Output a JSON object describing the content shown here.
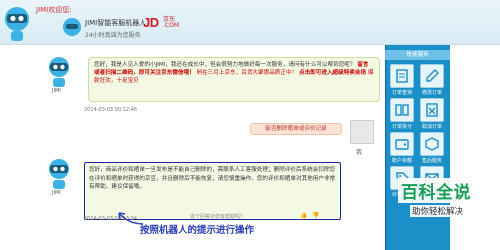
{
  "header": {
    "greeting": "JIMI欢迎您:",
    "bot_name": "JIMI智能客服机器人",
    "bot_subtitle": "24小时真诚为您服务",
    "jd_logo": "JD",
    "jd_logo_zh": "京东",
    "jd_logo_com": ".COM"
  },
  "chat": {
    "bot_label": "JIMI",
    "message1": {
      "text_a": "您好，我是人见人爱的小JIMI，我还在成长中，但会很努力地做好每一次服务，请问有什么可以帮到您呢？",
      "highlight_a": "留言或者扫描二维码，即可关注京东微信哦！",
      "highlight_b": "剁在三月上京东，百货大聚惠品质正中！",
      "highlight_c": "点击即可进入超级特卖会场",
      "highlight_d": "爆款狂欢，十足宝贝",
      "timestamp": "2014-03-03 00:12:46"
    },
    "user_message": {
      "text": "能否删除晒单或评价记录",
      "label": "我"
    },
    "message2": {
      "text": "您好，商品评价和晒单一旦发布是不能自己删除的，需联系人工客服处理；删除评价后系统会扣除您在评价和晒单时获得的京豆，并且删除后不能恢复，请您慎重操作。您的评价和晒单对其他用户非常有帮助，建议保留哦。",
      "timestamp": "2014-03-03 00:13:04",
      "feedback": "这个回答对您有帮助吗？"
    },
    "caption": "按照机器人的提示进行操作"
  },
  "panel": {
    "title": "快速服务",
    "buttons": [
      {
        "label": "订单查询",
        "icon": "order-icon"
      },
      {
        "label": "修改订单",
        "icon": "edit-icon"
      },
      {
        "label": "订单拆分",
        "icon": "split-icon"
      },
      {
        "label": "取消订单",
        "icon": "cancel-icon"
      },
      {
        "label": "账户余额",
        "icon": "wallet-icon"
      },
      {
        "label": "售后服务",
        "icon": "service-icon"
      },
      {
        "label": "价格保护",
        "icon": "price-icon"
      },
      {
        "label": "投诉",
        "icon": "mail-icon"
      }
    ]
  },
  "watermark": {
    "title": "百科全说",
    "subtitle": "助你轻松解决"
  },
  "colors": {
    "accent": "#1b8fc7",
    "bubble_bg": "#f4f9e4",
    "highlight": "#cc0000",
    "caption": "#2a3fb8",
    "watermark": "#159e54"
  }
}
